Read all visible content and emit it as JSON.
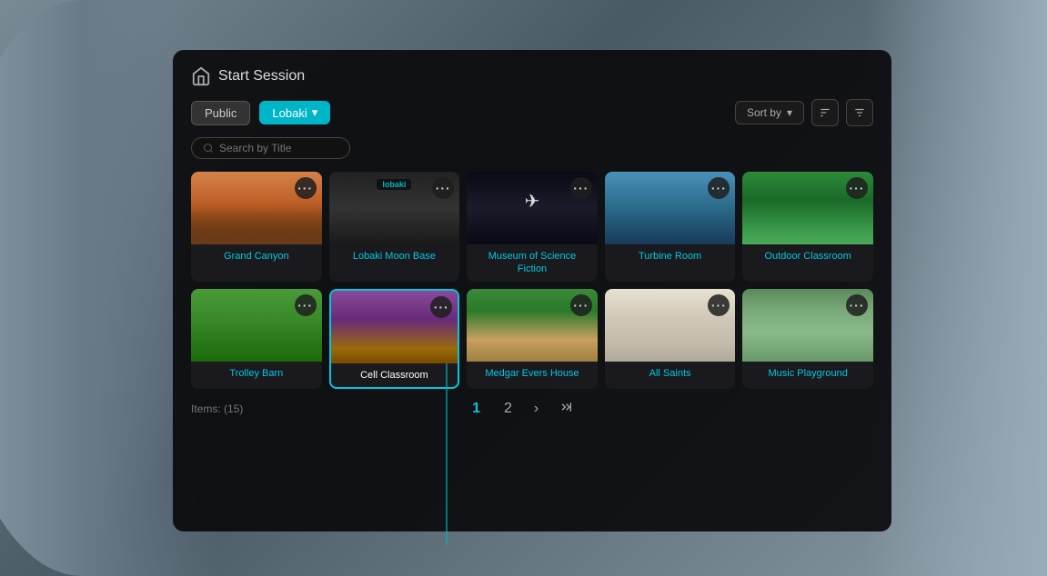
{
  "app": {
    "title": "Start Session",
    "homeIcon": "🏠"
  },
  "tabs": {
    "public": "Public",
    "lobaki": "Lobaki"
  },
  "search": {
    "placeholder": "Search by Title"
  },
  "sortBy": {
    "label": "Sort by"
  },
  "items": {
    "count": "Items: (15)"
  },
  "pagination": {
    "page1": "1",
    "page2": "2",
    "nextLabel": "›",
    "lastLabel": "⏭"
  },
  "cards": [
    {
      "id": "grand-canyon",
      "label": "Grand Canyon",
      "thumbClass": "thumb-grand-canyon",
      "selected": false
    },
    {
      "id": "lobaki-moon-base",
      "label": "Lobaki Moon Base",
      "thumbClass": "thumb-lobaki-moon",
      "selected": false
    },
    {
      "id": "museum-science-fiction",
      "label": "Museum of Science Fiction",
      "thumbClass": "thumb-museum",
      "selected": false
    },
    {
      "id": "turbine-room",
      "label": "Turbine Room",
      "thumbClass": "thumb-turbine",
      "selected": false
    },
    {
      "id": "outdoor-classroom",
      "label": "Outdoor Classroom",
      "thumbClass": "thumb-outdoor",
      "selected": false
    },
    {
      "id": "trolley-barn",
      "label": "Trolley Barn",
      "thumbClass": "thumb-trolley",
      "selected": false
    },
    {
      "id": "cell-classroom",
      "label": "Cell Classroom",
      "thumbClass": "thumb-cell",
      "selected": true
    },
    {
      "id": "medgar-evers-house",
      "label": "Medgar Evers House",
      "thumbClass": "thumb-medgar",
      "selected": false
    },
    {
      "id": "all-saints",
      "label": "All Saints",
      "thumbClass": "thumb-all-saints",
      "selected": false
    },
    {
      "id": "music-playground",
      "label": "Music Playground",
      "thumbClass": "thumb-music",
      "selected": false
    }
  ]
}
